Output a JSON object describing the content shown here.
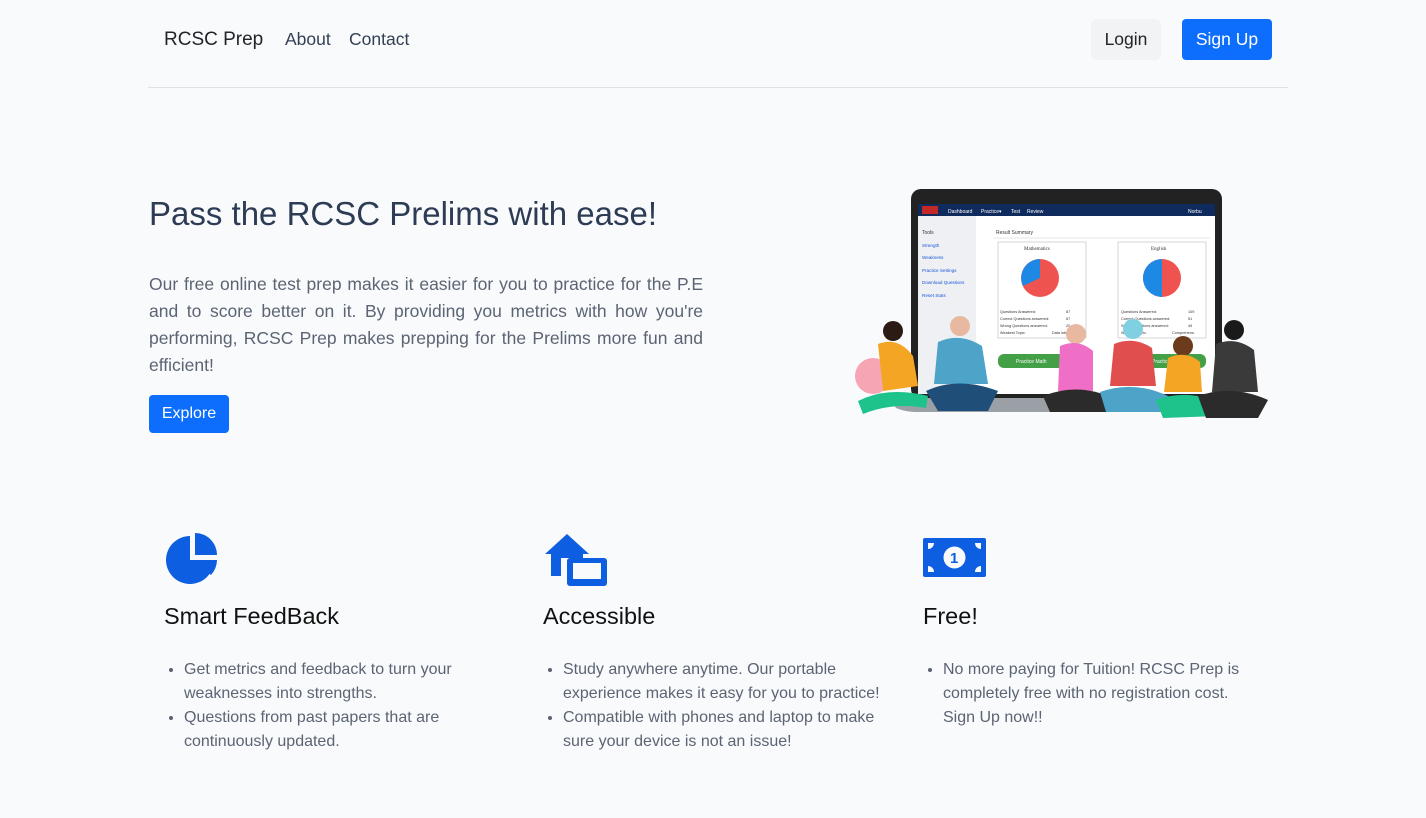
{
  "nav": {
    "brand": "RCSC Prep",
    "links": [
      "About",
      "Contact"
    ],
    "login": "Login",
    "signup": "Sign Up"
  },
  "hero": {
    "title": "Pass the RCSC Prelims with ease!",
    "description": "Our free online test prep makes it easier for you to practice for the P.E and to score better on it. By providing you metrics with how you're performing, RCSC Prep makes prepping for the Prelims more fun and efficient!",
    "cta": "Explore"
  },
  "screen": {
    "menu": [
      "Dashboard",
      "Practice▾",
      "Test",
      "Review"
    ],
    "user": "Norbu",
    "sidebar_title": "Tools",
    "sidebar": [
      "Strength",
      "Weakness",
      "Practice Settings",
      "Download Questions",
      "Reset Stats"
    ],
    "result_title": "Result Summary",
    "panels": [
      {
        "subject": "Mathematics",
        "rows": [
          [
            "Questions Answered:",
            "87"
          ],
          [
            "Correct Questions answered:",
            "67"
          ],
          [
            "Wrong Questions answered:",
            "20"
          ],
          [
            "Weakest Topic:",
            "Data interpr."
          ]
        ],
        "button": "Practice Math"
      },
      {
        "subject": "English",
        "rows": [
          [
            "Questions Answered:",
            "109"
          ],
          [
            "Correct Questions answered:",
            "51"
          ],
          [
            "Wrong Questions answered:",
            "49"
          ],
          [
            "Weakest Topic:",
            "Comprehens."
          ]
        ],
        "button": "Practice"
      }
    ]
  },
  "features": [
    {
      "icon": "pie-chart-icon",
      "title": "Smart FeedBack",
      "items": [
        "Get metrics and feedback to turn your weaknesses into strengths.",
        "Questions from past papers that are continuously updated."
      ]
    },
    {
      "icon": "house-laptop-icon",
      "title": "Accessible",
      "items": [
        "Study anywhere anytime. Our portable experience makes it easy for you to practice!",
        "Compatible with phones and laptop to make sure your device is not an issue!"
      ]
    },
    {
      "icon": "money-bill-icon",
      "title": "Free!",
      "items": [
        "No more paying for Tuition! RCSC Prep is completely free with no registration cost. Sign Up now!!"
      ]
    }
  ],
  "colors": {
    "primary": "#0d6efd",
    "background": "#f8fafc",
    "heading": "#2d3b55",
    "body_text": "#5c6473"
  }
}
